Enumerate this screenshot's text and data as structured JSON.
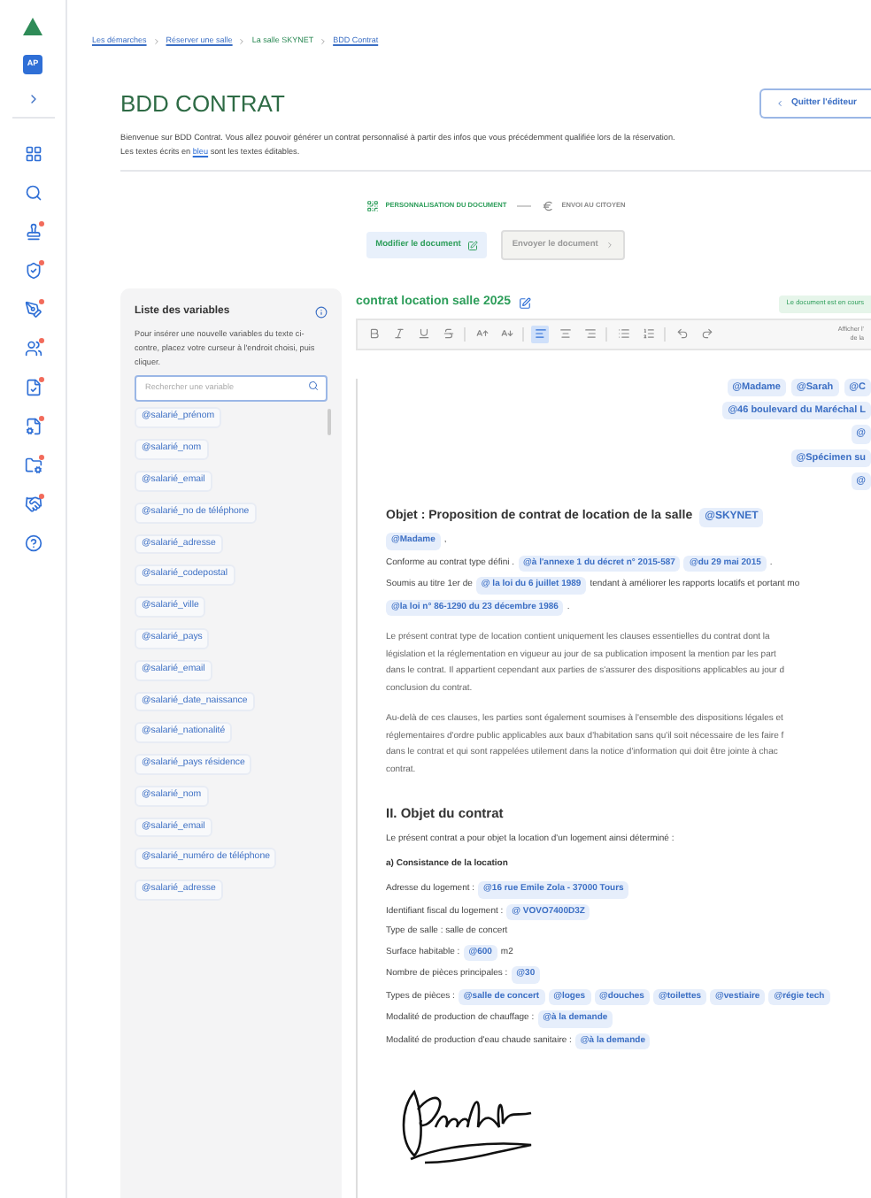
{
  "sidebar": {
    "avatar": "AP",
    "items": [
      {
        "kind": "grid",
        "badge": false
      },
      {
        "kind": "search",
        "badge": false
      },
      {
        "kind": "stamp",
        "badge": true
      },
      {
        "kind": "shield",
        "badge": true
      },
      {
        "kind": "pen",
        "badge": true
      },
      {
        "kind": "users",
        "badge": true
      },
      {
        "kind": "file-check",
        "badge": true
      },
      {
        "kind": "file-cog",
        "badge": true
      },
      {
        "kind": "folder",
        "badge": true
      },
      {
        "kind": "handshake",
        "badge": true
      },
      {
        "kind": "help",
        "badge": false
      }
    ]
  },
  "breadcrumb": [
    {
      "label": "Les démarches",
      "selected": false
    },
    {
      "label": "Réserver une salle",
      "selected": false
    },
    {
      "label": "La salle SKYNET",
      "selected": true
    },
    {
      "label": "BDD Contrat",
      "selected": false
    }
  ],
  "page_title": "BDD CONTRAT",
  "quit_button": "Quitter l'éditeur",
  "intro": {
    "line1": "Bienvenue sur BDD Contrat. Vous allez pouvoir générer un contrat personnalisé à partir des infos que vous précédemment qualifiée lors de la réservation.",
    "before": "Les textes écrits en",
    "link": "bleu",
    "after": "sont les textes éditables."
  },
  "steps": [
    {
      "label": "PERSONNALISATION DU DOCUMENT",
      "selected": true
    },
    {
      "label": "ENVOI AU CITOYEN",
      "selected": false
    }
  ],
  "actions": [
    {
      "label": "Modifier le document",
      "disabled": false
    },
    {
      "label": "Envoyer le document",
      "disabled": true
    }
  ],
  "variables": {
    "title": "Liste des variables",
    "help": "Pour insérer une nouvelle variables du texte ci-contre, placez votre curseur à l'endroit choisi, puis cliquer.",
    "placeholder": "Rechercher une variable",
    "items": [
      "@salarié_prénom",
      "@salarié_nom",
      "@salarié_email",
      "@salarié_no de téléphone",
      "@salarié_adresse",
      "@salarié_codepostal",
      "@salarié_ville",
      "@salarié_pays",
      "@salarié_email",
      "@salarié_date_naissance",
      "@salarié_nationalité",
      "@salarié_pays résidence",
      "@salarié_nom",
      "@salarié_email",
      "@salarié_numéro de téléphone",
      "@salarié_adresse"
    ]
  },
  "document": {
    "title": "contrat location salle 2025",
    "status": "Le document est en cours",
    "toolbar": [
      {
        "kind": "bold",
        "selected": false
      },
      {
        "kind": "italic",
        "selected": false
      },
      {
        "kind": "underline",
        "selected": false
      },
      {
        "kind": "strike",
        "selected": false
      },
      {
        "kind": "divider"
      },
      {
        "kind": "grow",
        "selected": false
      },
      {
        "kind": "shrink",
        "selected": false
      },
      {
        "kind": "divider"
      },
      {
        "kind": "align-left",
        "selected": true
      },
      {
        "kind": "align-center",
        "selected": false
      },
      {
        "kind": "align-right",
        "selected": false
      },
      {
        "kind": "divider"
      },
      {
        "kind": "list",
        "selected": false
      },
      {
        "kind": "ordered-list",
        "selected": false
      },
      {
        "kind": "divider"
      },
      {
        "kind": "undo",
        "selected": false
      },
      {
        "kind": "redo",
        "selected": false
      }
    ],
    "toolbar_hint": [
      "Afficher l'",
      "de la"
    ],
    "blocks": [
      {
        "kind": "chips_right",
        "chips": [
          "@Madame",
          "@Sarah",
          "@C"
        ]
      },
      {
        "kind": "chips_right",
        "chips": [
          "@46  boulevard du Maréchal L"
        ]
      },
      {
        "kind": "chips_right",
        "chips": [
          "@"
        ]
      },
      {
        "kind": "chips_right",
        "chips": [
          "@Spécimen su"
        ]
      },
      {
        "kind": "chips_right",
        "chips": [
          "@"
        ]
      },
      {
        "kind": "subject",
        "parts": [
          {
            "text": "Objet : Proposition de contrat de location de la salle"
          },
          {
            "chip": "@SKYNET"
          }
        ]
      },
      {
        "kind": "line",
        "parts": [
          {
            "chip": "@Madame"
          },
          {
            "text": ","
          }
        ]
      },
      {
        "kind": "line",
        "parts": [
          {
            "text": "Conforme au contrat type défini ."
          },
          {
            "chip": "@à l'annexe 1 du décret n° 2015-587"
          },
          {
            "chip": "@du 29 mai 2015"
          },
          {
            "text": "."
          }
        ]
      },
      {
        "kind": "line",
        "parts": [
          {
            "text": "Soumis au titre 1er de"
          },
          {
            "chip": "@ la loi du 6 juillet 1989"
          },
          {
            "text": "tendant à améliorer les rapports locatifs et portant mo"
          }
        ]
      },
      {
        "kind": "line",
        "parts": [
          {
            "chip": "@la loi n° 86-1290 du 23 décembre 1986"
          },
          {
            "text": "."
          }
        ]
      },
      {
        "kind": "paragraph",
        "lines": [
          "Le présent contrat type de location contient uniquement les clauses essentielles du contrat dont la",
          "législation et la réglementation en vigueur au jour de sa publication imposent la mention par les part",
          "dans le contrat. Il appartient cependant aux parties de s'assurer des dispositions applicables au jour d",
          "conclusion du contrat."
        ]
      },
      {
        "kind": "paragraph",
        "lines": [
          "Au-delà de ces clauses, les parties sont également soumises à l'ensemble des dispositions légales et",
          "réglementaires d'ordre public applicables aux baux d'habitation sans qu'il soit nécessaire de les faire f",
          "dans le contrat et qui sont rappelées utilement dans la notice d'information qui doit être jointe à chac",
          "contrat."
        ]
      },
      {
        "kind": "section",
        "parts": [
          {
            "text": "II. Objet du contrat"
          }
        ]
      },
      {
        "kind": "line",
        "parts": [
          {
            "text": "Le présent contrat a pour objet la location d'un logement ainsi déterminé :"
          }
        ]
      },
      {
        "kind": "subheading",
        "parts": [
          {
            "text": "a) Consistance de la location"
          }
        ]
      },
      {
        "kind": "line",
        "parts": [
          {
            "text": "Adresse du logement :"
          },
          {
            "chip": "@16 rue Emile Zola - 37000 Tours"
          }
        ]
      },
      {
        "kind": "line",
        "parts": [
          {
            "text": "Identifiant fiscal du logement :"
          },
          {
            "chip": "@ VOVO7400D3Z"
          }
        ]
      },
      {
        "kind": "line",
        "parts": [
          {
            "text": "Type de salle : salle de concert"
          }
        ]
      },
      {
        "kind": "line",
        "parts": [
          {
            "text": "Surface habitable :"
          },
          {
            "chip": "@600"
          },
          {
            "text": "m2"
          }
        ]
      },
      {
        "kind": "line",
        "parts": [
          {
            "text": "Nombre de pièces principales :"
          },
          {
            "chip": "@30"
          }
        ]
      },
      {
        "kind": "line",
        "parts": [
          {
            "text": "Types de pièces :"
          },
          {
            "chip": "@salle de concert"
          },
          {
            "chip": "@loges"
          },
          {
            "chip": "@douches"
          },
          {
            "chip": "@toilettes"
          },
          {
            "chip": "@vestiaire"
          },
          {
            "chip": "@régie tech"
          }
        ]
      },
      {
        "kind": "line",
        "parts": [
          {
            "text": "Modalité de production de chauffage :"
          },
          {
            "chip": "@à la demande"
          }
        ]
      },
      {
        "kind": "line",
        "parts": [
          {
            "text": "Modalité de production d'eau chaude sanitaire :"
          },
          {
            "chip": "@à la demande"
          }
        ]
      },
      {
        "kind": "signature"
      }
    ]
  }
}
